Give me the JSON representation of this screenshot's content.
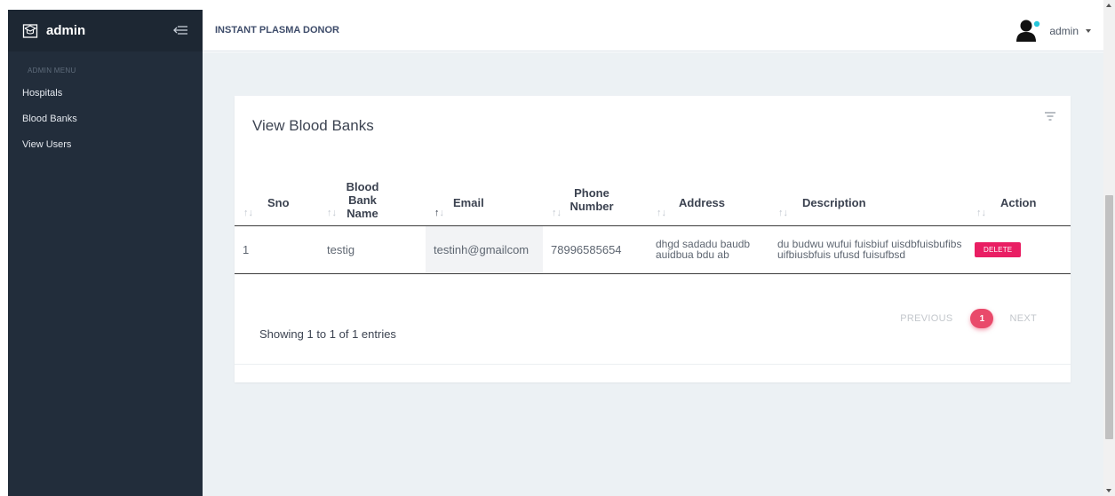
{
  "sidebar": {
    "brand": "admin",
    "menu_heading": "ADMIN MENU",
    "items": [
      {
        "label": "Hospitals"
      },
      {
        "label": "Blood Banks"
      },
      {
        "label": "View Users"
      }
    ]
  },
  "header": {
    "app_title": "INSTANT PLASMA DONOR",
    "user_name": "admin"
  },
  "card": {
    "title": "View Blood Banks",
    "columns": [
      "Sno",
      "Blood Bank Name",
      "Email",
      "Phone Number",
      "Address",
      "Description",
      "Action"
    ],
    "rows": [
      {
        "sno": "1",
        "name": "testig",
        "email": "testinh@gmailcom",
        "phone": "78996585654",
        "address": "dhgd sadadu baudb auidbua bdu ab",
        "description": "du budwu wufui fuisbiuf uisdbfuisbufibs uifbiusbfuis ufusd fuisufbsd",
        "action": "DELETE"
      }
    ],
    "showing": "Showing 1 to 1 of 1 entries",
    "pagination": {
      "previous": "PREVIOUS",
      "current_page": "1",
      "next": "NEXT"
    }
  },
  "colors": {
    "sidebar": "#222d3b",
    "accent": "#e91e63",
    "content_bg": "#ecf1f4"
  },
  "icons": [
    "graduation-cap-icon",
    "collapse-menu-icon",
    "user-avatar-icon",
    "filter-icon",
    "sort-arrows-icon"
  ]
}
